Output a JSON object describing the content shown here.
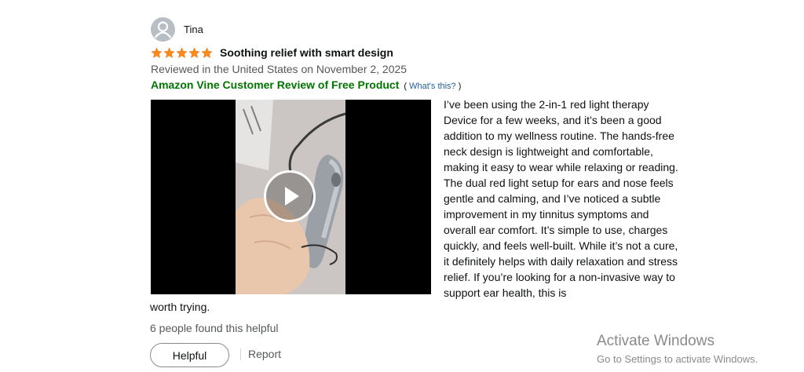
{
  "reviewer": {
    "name": "Tina",
    "icon": "user-avatar-icon"
  },
  "review": {
    "rating": 5,
    "rating_max": 5,
    "title": "Soothing relief with smart design",
    "date": "Reviewed in the United States on November 2, 2025",
    "vine_label": "Amazon Vine Customer Review of Free Product",
    "whats_this_open": "(",
    "whats_this_link": "What's this?",
    "whats_this_close": ")",
    "body_text": "I’ve been using the 2-in-1 red light therapy Device for a few weeks, and it’s been a good addition to my wellness routine. The hands-free neck design is lightweight and comfortable, making it easy to wear while relaxing or reading. The dual red light setup for ears and nose feels gentle and calming, and I’ve noticed a subtle improvement in my tinnitus symptoms and overall ear comfort. It’s simple to use, charges quickly, and feels well-built. While it’s not a cure, it definitely helps with daily relaxation and stress relief. If you’re looking for a non-invasive way to support ear health, this is",
    "body_text_cont": "worth trying.",
    "helpful_count_text": "6 people found this helpful"
  },
  "video": {
    "play_icon": "play-icon"
  },
  "actions": {
    "helpful_label": "Helpful",
    "report_label": "Report"
  },
  "watermark": {
    "title": "Activate Windows",
    "subtitle": "Go to Settings to activate Windows."
  },
  "colors": {
    "star": "#ff8c1a",
    "vine_green": "#007600",
    "link_blue": "#2162a1",
    "muted": "#565959"
  }
}
